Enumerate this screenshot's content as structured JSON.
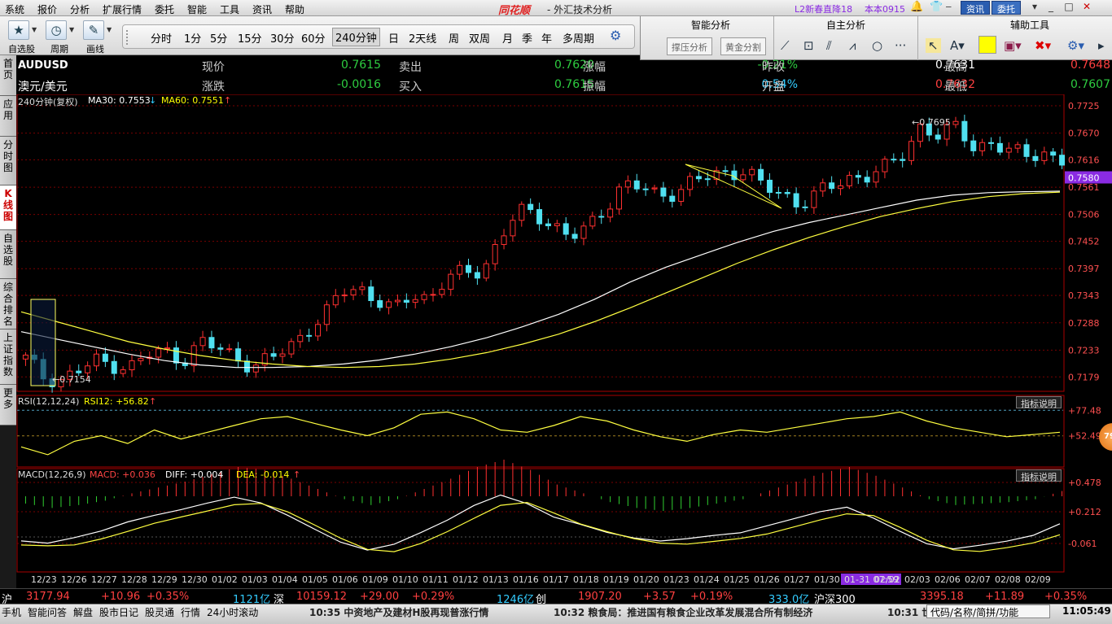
{
  "menu": {
    "items": [
      "系统",
      "报价",
      "分析",
      "扩展行情",
      "委托",
      "智能",
      "工具",
      "资讯",
      "帮助"
    ],
    "logo": "同花顺",
    "app_title": "- 外汇技术分析",
    "promo": "L2新春直降18",
    "version": "本本0915",
    "news_btn": "资讯",
    "trade_btn": "委托"
  },
  "toolbar": {
    "tools": [
      {
        "label": "自选股",
        "icon": "star-icon"
      },
      {
        "label": "周期",
        "icon": "clock-icon"
      },
      {
        "label": "画线",
        "icon": "pen-icon"
      }
    ],
    "periods": [
      "分时",
      "1分",
      "5分",
      "15分",
      "30分",
      "60分",
      "240分钟",
      "日",
      "2天线",
      "周",
      "双周",
      "月",
      "季",
      "年",
      "多周期"
    ],
    "active_period": "240分钟"
  },
  "analysis": {
    "smart_title": "智能分析",
    "self_title": "自主分析",
    "aux_title": "辅助工具",
    "btn_support": "撑压分析",
    "btn_golden": "黄金分割",
    "highlight_color": "#ffff00"
  },
  "sidebar": {
    "tabs": [
      "首页",
      "应用",
      "分时图",
      "K线图",
      "自选股",
      "综合排名",
      "上证指数",
      "更多"
    ],
    "active": "K线图"
  },
  "quote": {
    "symbol": "AUDUSD",
    "name": "澳元/美元",
    "rows": [
      [
        {
          "l": "现价",
          "v": "0.7615",
          "c": "g"
        },
        {
          "l": "卖出",
          "v": "0.7620",
          "c": "g"
        },
        {
          "l": "涨幅",
          "v": "-0.21%",
          "c": "g"
        },
        {
          "l": "昨收",
          "v": "0.7631",
          "c": "w"
        },
        {
          "l": "最高",
          "v": "0.7648",
          "c": "r"
        }
      ],
      [
        {
          "l": "涨跌",
          "v": "-0.0016",
          "c": "g"
        },
        {
          "l": "买入",
          "v": "0.7615",
          "c": "g"
        },
        {
          "l": "振幅",
          "v": "0.54%",
          "c": "c"
        },
        {
          "l": "开盘",
          "v": "0.7632",
          "c": "r"
        },
        {
          "l": "最低",
          "v": "0.7607",
          "c": "g"
        }
      ]
    ]
  },
  "main_chart": {
    "period_label": "240分钟(复权)",
    "ma30_label": "MA30: 0.7553",
    "ma30_arrow": "↓",
    "ma60_label": "MA60: 0.7551",
    "ma60_arrow": "↑",
    "y_ticks": [
      "0.7725",
      "0.7670",
      "0.7616",
      "0.7561",
      "0.7506",
      "0.7452",
      "0.7397",
      "0.7343",
      "0.7288",
      "0.7233",
      "0.7179"
    ],
    "current_price_tag": "0.7580",
    "high_annotation": "0.7695",
    "low_annotation": "0.7154",
    "x_dates": [
      "12/23",
      "12/26",
      "12/27",
      "12/28",
      "12/29",
      "12/30",
      "01/02",
      "01/03",
      "01/04",
      "01/05",
      "01/06",
      "01/09",
      "01/10",
      "01/11",
      "01/12",
      "01/13",
      "01/16",
      "01/17",
      "01/18",
      "01/19",
      "01/20",
      "01/23",
      "01/24",
      "01/25",
      "01/26",
      "01/27",
      "01/30",
      "01-31 07:59",
      "02/02",
      "02/03",
      "02/06",
      "02/07",
      "02/08",
      "02/09"
    ],
    "cursor_date": "01-31 07:59"
  },
  "rsi": {
    "label": "RSI(12,12,24)",
    "value_label": "RSI12: +56.82",
    "arrow": "↑",
    "button": "指标说明",
    "y_ticks": [
      "+77.48",
      "+52.49"
    ]
  },
  "macd": {
    "label": "MACD(12,26,9)",
    "macd_label": "MACD: +0.036",
    "diff_label": "DIFF: +0.004",
    "dea_label": "DEA: -0.014",
    "arrow": "↑",
    "button": "指标说明",
    "y_ticks": [
      "+0.478",
      "+0.212",
      "-0.061"
    ]
  },
  "float_badge": "79",
  "chart_data": {
    "type": "candlestick",
    "series": [
      {
        "name": "K线",
        "values": [
          0.7215,
          0.718,
          0.7175,
          0.719,
          0.721,
          0.7205,
          0.72,
          0.7222,
          0.723,
          0.7215,
          0.7248,
          0.7235,
          0.722,
          0.72,
          0.7215,
          0.724,
          0.7275,
          0.73,
          0.735,
          0.736,
          0.7335,
          0.731,
          0.7345,
          0.734,
          0.738,
          0.7385,
          0.7395,
          0.746,
          0.751,
          0.7505,
          0.749,
          0.746,
          0.7475,
          0.752,
          0.757,
          0.756,
          0.754,
          0.7555,
          0.7575,
          0.758,
          0.759,
          0.76,
          0.756,
          0.7545,
          0.753,
          0.755,
          0.756,
          0.758,
          0.759,
          0.76,
          0.7625,
          0.769,
          0.7665,
          0.768,
          0.764,
          0.7655,
          0.763,
          0.7625,
          0.7632,
          0.7615
        ]
      },
      {
        "name": "MA30",
        "values": [
          0.727,
          0.7255,
          0.724,
          0.7225,
          0.7212,
          0.7203,
          0.7198,
          0.7198,
          0.72,
          0.7205,
          0.7213,
          0.7225,
          0.724,
          0.7258,
          0.728,
          0.7305,
          0.7335,
          0.737,
          0.74,
          0.7425,
          0.745,
          0.7472,
          0.749,
          0.7505,
          0.752,
          0.7535,
          0.7545,
          0.755,
          0.7552,
          0.7553
        ]
      },
      {
        "name": "MA60",
        "values": [
          0.731,
          0.729,
          0.727,
          0.725,
          0.7235,
          0.7222,
          0.7212,
          0.7205,
          0.72,
          0.7198,
          0.72,
          0.7205,
          0.7215,
          0.7228,
          0.7245,
          0.7265,
          0.729,
          0.7318,
          0.7348,
          0.7378,
          0.7408,
          0.7435,
          0.746,
          0.7482,
          0.7502,
          0.7518,
          0.7532,
          0.7542,
          0.7548,
          0.7551
        ]
      }
    ],
    "rsi12": [
      45,
      38,
      50,
      55,
      48,
      60,
      52,
      58,
      64,
      70,
      72,
      66,
      60,
      55,
      62,
      74,
      76,
      70,
      60,
      58,
      64,
      72,
      68,
      60,
      54,
      50,
      56,
      60,
      58,
      62,
      66,
      70,
      72,
      76,
      68,
      62,
      58,
      54,
      56,
      58
    ],
    "macd_hist": [
      -0.05,
      -0.08,
      -0.06,
      -0.03,
      0.02,
      0.06,
      0.1,
      0.15,
      0.2,
      0.18,
      0.12,
      0.05,
      -0.02,
      -0.06,
      -0.02,
      0.05,
      0.12,
      0.2,
      0.25,
      0.18,
      0.08,
      0.02,
      -0.04,
      -0.08,
      -0.1,
      -0.08,
      -0.05,
      -0.02,
      0.04,
      0.1,
      0.16,
      0.2,
      0.14,
      0.06,
      -0.02,
      -0.06,
      -0.05,
      -0.04,
      -0.02,
      0.036
    ],
    "ylim": [
      0.715,
      0.7725
    ]
  }
}
